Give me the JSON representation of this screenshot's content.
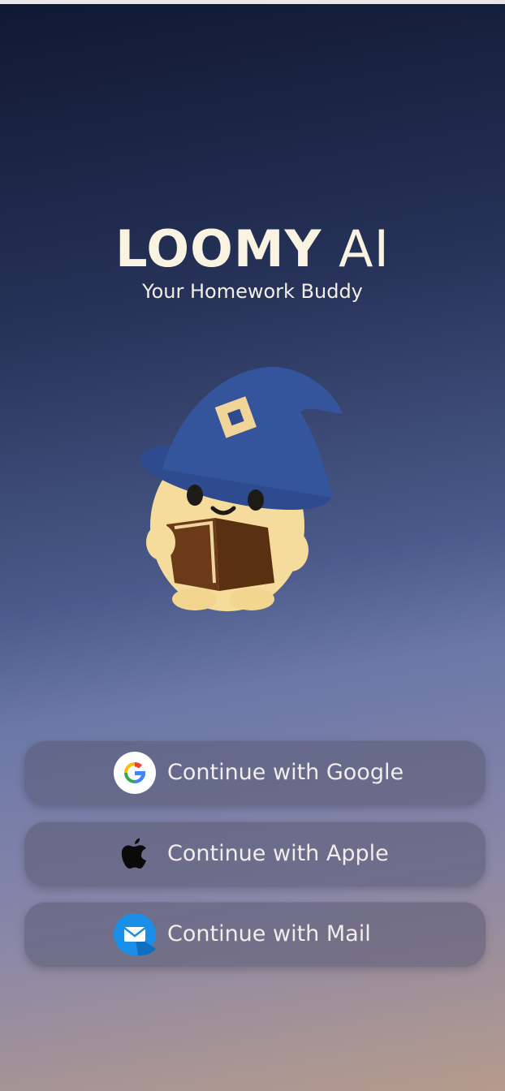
{
  "app": {
    "title_bold": "LOOMY",
    "title_light": "AI",
    "tagline": "Your Homework Buddy"
  },
  "mascot": {
    "icon": "wizard-mascot-reading-book-icon"
  },
  "auth": {
    "buttons": [
      {
        "label": "Continue with Google",
        "icon": "google-icon"
      },
      {
        "label": "Continue with Apple",
        "icon": "apple-icon"
      },
      {
        "label": "Continue with Mail",
        "icon": "mail-icon"
      }
    ]
  },
  "colors": {
    "title": "#fbf3e1",
    "hat": "#2f4f93",
    "mascot_body": "#f6dc9c",
    "book": "#6b3a18"
  }
}
